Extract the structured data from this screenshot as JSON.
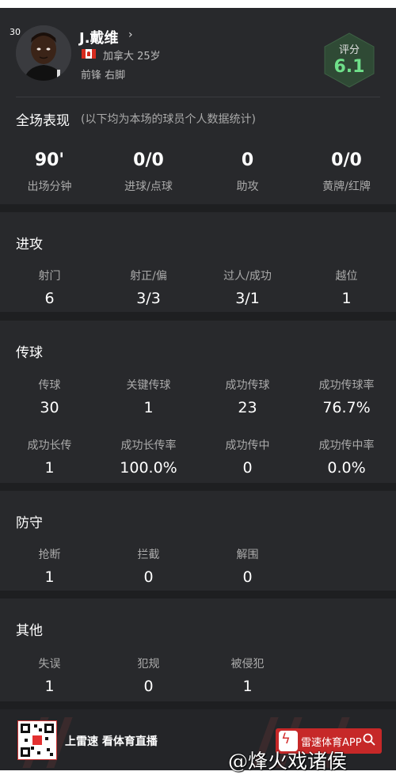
{
  "player": {
    "jersey": "30",
    "name": "J.戴维",
    "chevron": "›",
    "country_age": "加拿大 25岁",
    "position_foot": "前锋  右脚"
  },
  "rating": {
    "label": "评分",
    "value": "6.1"
  },
  "overview": {
    "title": "全场表现",
    "subtitle": "(以下均为本场的球员个人数据统计)",
    "stats": [
      {
        "value": "90'",
        "label": "出场分钟"
      },
      {
        "value": "0/0",
        "label": "进球/点球"
      },
      {
        "value": "0",
        "label": "助攻"
      },
      {
        "value": "0/0",
        "label": "黄牌/红牌"
      }
    ]
  },
  "attack": {
    "title": "进攻",
    "stats": [
      {
        "label": "射门",
        "value": "6"
      },
      {
        "label": "射正/偏",
        "value": "3/3"
      },
      {
        "label": "过人/成功",
        "value": "3/1"
      },
      {
        "label": "越位",
        "value": "1"
      }
    ]
  },
  "passing": {
    "title": "传球",
    "stats": [
      {
        "label": "传球",
        "value": "30"
      },
      {
        "label": "关键传球",
        "value": "1"
      },
      {
        "label": "成功传球",
        "value": "23"
      },
      {
        "label": "成功传球率",
        "value": "76.7%"
      },
      {
        "label": "成功长传",
        "value": "1"
      },
      {
        "label": "成功长传率",
        "value": "100.0%"
      },
      {
        "label": "成功传中",
        "value": "0"
      },
      {
        "label": "成功传中率",
        "value": "0.0%"
      }
    ]
  },
  "defense": {
    "title": "防守",
    "stats": [
      {
        "label": "抢断",
        "value": "1"
      },
      {
        "label": "拦截",
        "value": "0"
      },
      {
        "label": "解围",
        "value": "0"
      }
    ]
  },
  "other": {
    "title": "其他",
    "stats": [
      {
        "label": "失误",
        "value": "1"
      },
      {
        "label": "犯规",
        "value": "0"
      },
      {
        "label": "被侵犯",
        "value": "1"
      }
    ]
  },
  "footer": {
    "promo": "上雷速 看体育直播",
    "app_name": "雷速体育APP",
    "search_icon": "search-icon",
    "bolt_icon": "bolt-icon"
  },
  "watermark": "@烽火戏诸侯",
  "colors": {
    "rating": "#6fe08a",
    "card": "#28292c",
    "brand": "#c62828"
  }
}
